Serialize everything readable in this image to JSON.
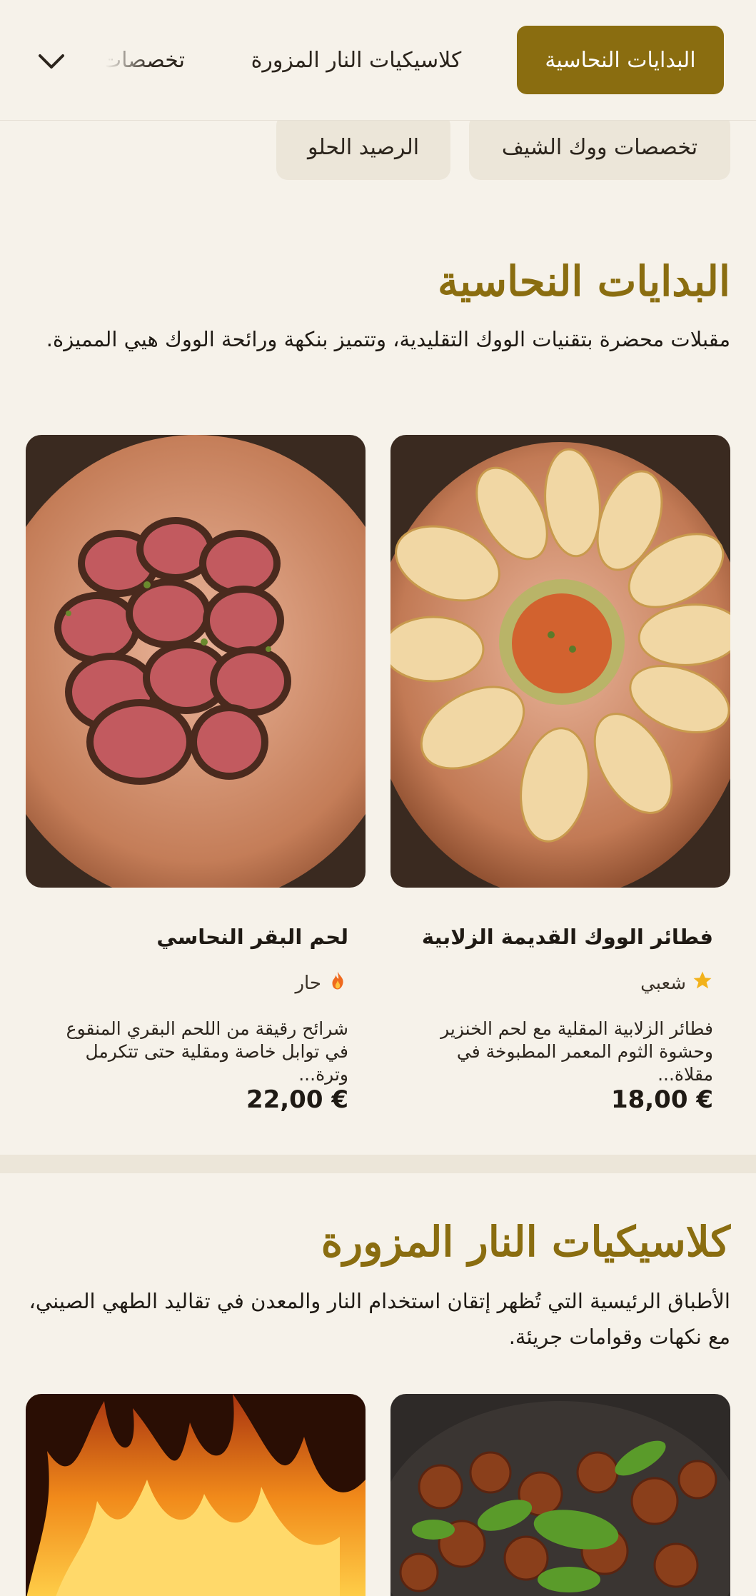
{
  "nav": {
    "tabs": [
      {
        "label": "البدايات النحاسية",
        "active": true
      },
      {
        "label": "كلاسيكيات النار المزورة",
        "active": false
      },
      {
        "label": "تخصصات",
        "active": false
      }
    ],
    "pills": [
      {
        "label": "تخصصات ووك الشيف"
      },
      {
        "label": "الرصيد الحلو"
      }
    ],
    "accent_color": "#8a6d10"
  },
  "sections": [
    {
      "title": "البدايات النحاسية",
      "description": "مقبلات محضرة بتقنيات الووك التقليدية، وتتميز بنكهة ورائحة الووك هيي المميزة.",
      "items": [
        {
          "name": "فطائر الووك القديمة الزلابية",
          "badge_icon": "star-icon",
          "badge": "شعبي",
          "description": "فطائر الزلابية المقلية مع لحم الخنزير وحشوة الثوم المعمر المطبوخة في مقلاة...",
          "price": "18,00 €"
        },
        {
          "name": "لحم البقر النحاسي",
          "badge_icon": "fire-icon",
          "badge": "حار",
          "description": "شرائح رقيقة من اللحم البقري المنقوع في توابل خاصة ومقلية حتى تتكرمل وترة...",
          "price": "22,00 €"
        }
      ]
    },
    {
      "title": "كلاسيكيات النار المزورة",
      "description": "الأطباق الرئيسية التي تُظهر إتقان استخدام النار والمعدن في تقاليد الطهي الصيني، مع نكهات وقوامات جريئة."
    }
  ]
}
